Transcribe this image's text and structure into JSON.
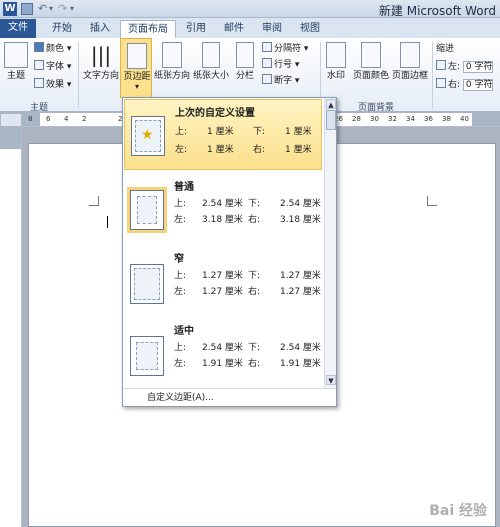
{
  "titlebar": {
    "app_icon": "W",
    "title": "新建 Microsoft Word"
  },
  "tabs": [
    {
      "label": "文件"
    },
    {
      "label": "开始"
    },
    {
      "label": "插入"
    },
    {
      "label": "页面布局"
    },
    {
      "label": "引用"
    },
    {
      "label": "邮件"
    },
    {
      "label": "审阅"
    },
    {
      "label": "视图"
    }
  ],
  "ribbon": {
    "theme": {
      "label": "主题",
      "colors": "颜色",
      "fonts": "字体",
      "effects": "效果",
      "group": "主题"
    },
    "text_direction": "文字方向",
    "margins": "页边距",
    "orientation": "纸张方向",
    "size": "纸张大小",
    "columns": "分栏",
    "breaks": "分隔符",
    "line_numbers": "行号",
    "hyphenation": "断字",
    "watermark": "水印",
    "page_color": "页面颜色",
    "page_border": "页面边框",
    "page_bg_group": "页面背景",
    "indent": {
      "label": "缩进",
      "left": "左:",
      "right": "右:",
      "left_val": "0 字符",
      "right_val": "0 字符"
    }
  },
  "dropdown": {
    "entries": [
      {
        "title": "上次的自定义设置",
        "top_lbl": "上:",
        "top": "1 厘米",
        "bottom_lbl": "下:",
        "bottom": "1 厘米",
        "left_lbl": "左:",
        "left": "1 厘米",
        "right_lbl": "右:",
        "right": "1 厘米"
      },
      {
        "title": "普通",
        "top_lbl": "上:",
        "top": "2.54 厘米",
        "bottom_lbl": "下:",
        "bottom": "2.54 厘米",
        "left_lbl": "左:",
        "left": "3.18 厘米",
        "right_lbl": "右:",
        "right": "3.18 厘米"
      },
      {
        "title": "窄",
        "top_lbl": "上:",
        "top": "1.27 厘米",
        "bottom_lbl": "下:",
        "bottom": "1.27 厘米",
        "left_lbl": "左:",
        "left": "1.27 厘米",
        "right_lbl": "右:",
        "right": "1.27 厘米"
      },
      {
        "title": "适中",
        "top_lbl": "上:",
        "top": "2.54 厘米",
        "bottom_lbl": "下:",
        "bottom": "2.54 厘米",
        "left_lbl": "左:",
        "left": "1.91 厘米",
        "right_lbl": "右:",
        "right": "1.91 厘米"
      }
    ],
    "custom": "自定义边距(A)..."
  },
  "ruler": {
    "ticks": [
      "8",
      "6",
      "4",
      "2",
      "",
      "2",
      "4",
      "6",
      "8",
      "10",
      "12",
      "14",
      "16",
      "18",
      "20",
      "22",
      "24",
      "26",
      "28",
      "30",
      "32",
      "34",
      "36",
      "38",
      "40"
    ]
  },
  "watermark": "Bai 经验"
}
